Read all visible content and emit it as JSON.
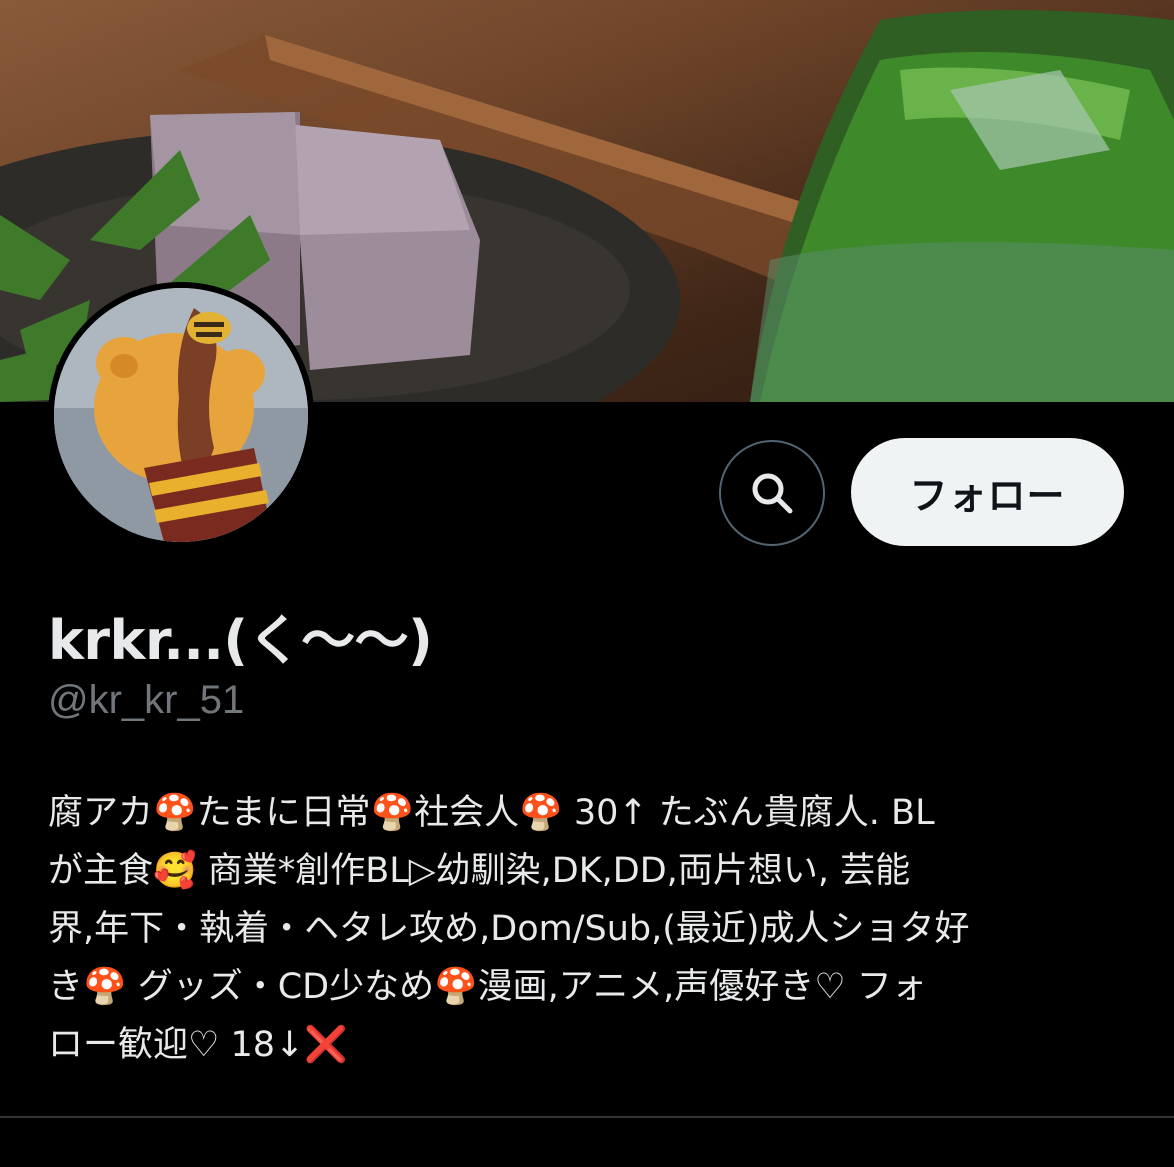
{
  "profile": {
    "display_name": "krkr...(く〜〜)",
    "handle": "@kr_kr_51",
    "bio": "腐アカ🍄たまに日常🍄社会人🍄 30↑ たぶん貴腐人. BL\nが主食🥰 商業*創作BL▷幼馴染,DK,DD,両片想い, 芸能\n界,年下・執着・ヘタレ攻め,Dom/Sub,(最近)成人ショタ好\nき🍄 グッズ・CD少なめ🍄漫画,アニメ,声優好き♡ フォ\nロー歓迎♡ 18↓❌"
  },
  "actions": {
    "search_icon": "search-icon",
    "follow_label": "フォロー"
  },
  "colors": {
    "background": "#000000",
    "text_primary": "#e7e9ea",
    "text_secondary": "#71767b",
    "follow_bg": "#eff3f4",
    "border": "#536471"
  }
}
